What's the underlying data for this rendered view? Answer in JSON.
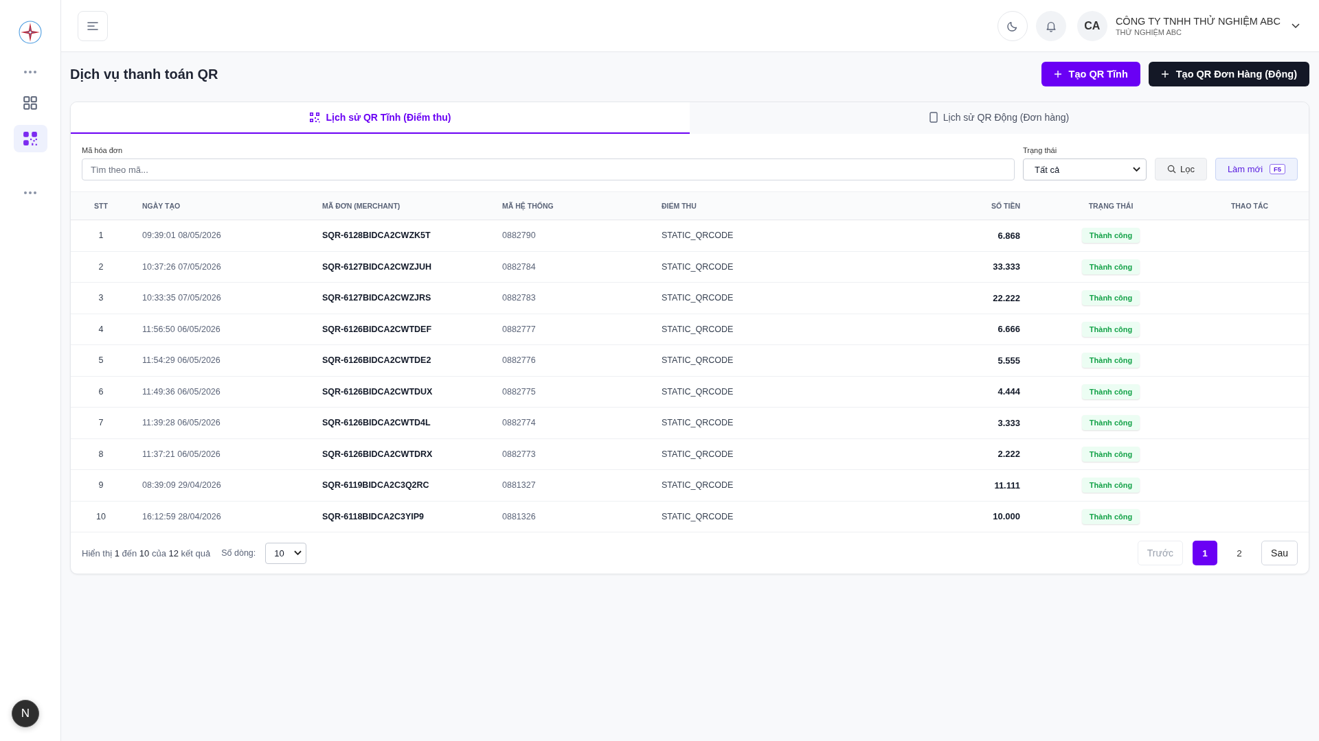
{
  "sidebar": {
    "items": [
      {
        "kind": "more",
        "selected": false
      },
      {
        "kind": "grid",
        "selected": false
      },
      {
        "kind": "qr",
        "selected": true
      },
      {
        "kind": "more",
        "selected": false
      }
    ]
  },
  "dev_badge": {
    "label": "N"
  },
  "header": {
    "avatar": "CA",
    "company": "CÔNG TY TNHH THỬ NGHIỆM ABC",
    "subtitle": "THỬ NGHIỆM ABC"
  },
  "page": {
    "title": "Dịch vụ thanh toán QR",
    "actions": [
      {
        "label": "Tạo QR Tĩnh",
        "kind": "primary"
      },
      {
        "label": "Tạo QR Đơn Hàng (Động)",
        "kind": "dark"
      }
    ]
  },
  "tabs": [
    {
      "label": "Lịch sử QR Tĩnh (Điểm thu)",
      "kind": "qr",
      "selected": true
    },
    {
      "label": "Lịch sử QR Động (Đơn hàng)",
      "kind": "phone",
      "selected": false
    }
  ],
  "filters": {
    "code_label": "Mã hóa đơn",
    "code_placeholder": "Tìm theo mã...",
    "status_label": "Trạng thái",
    "status_value": "Tất cả",
    "filter_button": "Lọc",
    "refresh_button": "Làm mới",
    "refresh_key": "F5"
  },
  "table": {
    "columns": [
      "STT",
      "NGÀY TẠO",
      "MÃ ĐƠN (MERCHANT)",
      "MÃ HỆ THỐNG",
      "ĐIỂM THU",
      "SỐ TIỀN",
      "TRẠNG THÁI",
      "THAO TÁC"
    ],
    "rows": [
      {
        "stt": "1",
        "created": "09:39:01 08/05/2026",
        "merchant_code": "SQR-6128BIDCA2CWZK5T",
        "system_code": "0882790",
        "point": "STATIC_QRCODE",
        "amount": "6.868",
        "status": "Thành công",
        "kind": "success"
      },
      {
        "stt": "2",
        "created": "10:37:26 07/05/2026",
        "merchant_code": "SQR-6127BIDCA2CWZJUH",
        "system_code": "0882784",
        "point": "STATIC_QRCODE",
        "amount": "33.333",
        "status": "Thành công",
        "kind": "success"
      },
      {
        "stt": "3",
        "created": "10:33:35 07/05/2026",
        "merchant_code": "SQR-6127BIDCA2CWZJRS",
        "system_code": "0882783",
        "point": "STATIC_QRCODE",
        "amount": "22.222",
        "status": "Thành công",
        "kind": "success"
      },
      {
        "stt": "4",
        "created": "11:56:50 06/05/2026",
        "merchant_code": "SQR-6126BIDCA2CWTDEF",
        "system_code": "0882777",
        "point": "STATIC_QRCODE",
        "amount": "6.666",
        "status": "Thành công",
        "kind": "success"
      },
      {
        "stt": "5",
        "created": "11:54:29 06/05/2026",
        "merchant_code": "SQR-6126BIDCA2CWTDE2",
        "system_code": "0882776",
        "point": "STATIC_QRCODE",
        "amount": "5.555",
        "status": "Thành công",
        "kind": "success"
      },
      {
        "stt": "6",
        "created": "11:49:36 06/05/2026",
        "merchant_code": "SQR-6126BIDCA2CWTDUX",
        "system_code": "0882775",
        "point": "STATIC_QRCODE",
        "amount": "4.444",
        "status": "Thành công",
        "kind": "success"
      },
      {
        "stt": "7",
        "created": "11:39:28 06/05/2026",
        "merchant_code": "SQR-6126BIDCA2CWTD4L",
        "system_code": "0882774",
        "point": "STATIC_QRCODE",
        "amount": "3.333",
        "status": "Thành công",
        "kind": "success"
      },
      {
        "stt": "8",
        "created": "11:37:21 06/05/2026",
        "merchant_code": "SQR-6126BIDCA2CWTDRX",
        "system_code": "0882773",
        "point": "STATIC_QRCODE",
        "amount": "2.222",
        "status": "Thành công",
        "kind": "success"
      },
      {
        "stt": "9",
        "created": "08:39:09 29/04/2026",
        "merchant_code": "SQR-6119BIDCA2C3Q2RC",
        "system_code": "0881327",
        "point": "STATIC_QRCODE",
        "amount": "11.111",
        "status": "Thành công",
        "kind": "success"
      },
      {
        "stt": "10",
        "created": "16:12:59 28/04/2026",
        "merchant_code": "SQR-6118BIDCA2C3YIP9",
        "system_code": "0881326",
        "point": "STATIC_QRCODE",
        "amount": "10.000",
        "status": "Thành công",
        "kind": "success"
      }
    ]
  },
  "pagination": {
    "summary": "Hiển thị **1** đến **10** của **12** kết quả",
    "rows_label": "Số dòng:",
    "rows_value": "10",
    "prev": {
      "label": "Trước",
      "disabled": true
    },
    "pages": [
      {
        "label": "1",
        "selected": true
      },
      {
        "label": "2",
        "selected": false
      }
    ],
    "next": {
      "label": "Sau",
      "disabled": false
    }
  }
}
